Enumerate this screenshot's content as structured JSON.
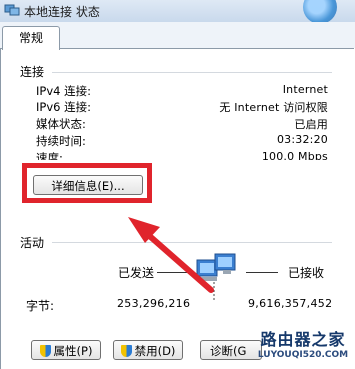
{
  "window": {
    "title": "本地连接 状态"
  },
  "tabs": [
    {
      "label": "常规"
    }
  ],
  "connection": {
    "section_label": "连接",
    "rows": [
      {
        "label": "IPv4 连接:",
        "value": "Internet"
      },
      {
        "label": "IPv6 连接:",
        "value": "无 Internet 访问权限"
      },
      {
        "label": "媒体状态:",
        "value": "已启用"
      },
      {
        "label": "持续时间:",
        "value": "03:32:20"
      },
      {
        "label": "速度:",
        "value": "100.0 Mbps"
      }
    ],
    "details_button": "详细信息(E)..."
  },
  "activity": {
    "section_label": "活动",
    "sent_label": "已发送",
    "received_label": "已接收",
    "bytes_label": "字节:",
    "bytes_sent": "253,296,216",
    "bytes_received": "9,616,357,452"
  },
  "buttons": {
    "properties": "属性(P)",
    "disable": "禁用(D)",
    "diagnose": "诊断(G"
  },
  "watermark": {
    "main": "路由器之家",
    "sub": "LUYOUQI520.COM"
  },
  "colors": {
    "highlight": "#e0242c",
    "arrow": "#e0242c",
    "title_bar": "#d4e1f0"
  }
}
